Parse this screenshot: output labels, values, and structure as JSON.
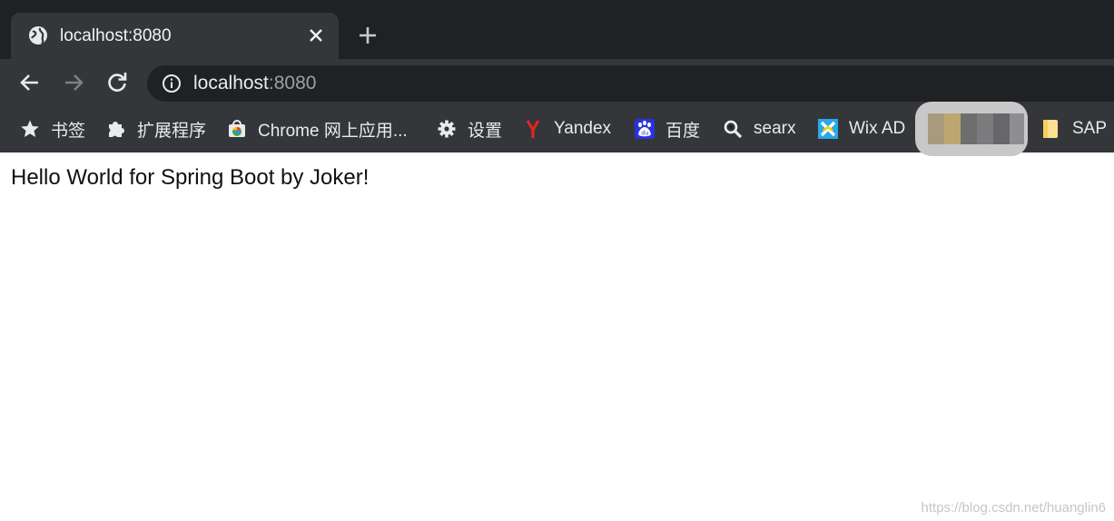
{
  "tab": {
    "title": "localhost:8080",
    "favicon": "globe-icon",
    "close_icon": "close-icon"
  },
  "new_tab_icon": "plus-icon",
  "toolbar": {
    "back_icon": "back-arrow-icon",
    "forward_icon": "forward-arrow-icon",
    "reload_icon": "reload-icon"
  },
  "omnibox": {
    "info_icon": "info-icon",
    "host": "localhost",
    "port": ":8080"
  },
  "bookmarks": [
    {
      "label": "书签",
      "icon": "star-icon"
    },
    {
      "label": "扩展程序",
      "icon": "puzzle-icon"
    },
    {
      "label": "Chrome 网上应用...",
      "icon": "chrome-store-icon"
    },
    {
      "label": "设置",
      "icon": "gear-icon"
    },
    {
      "label": "Yandex",
      "icon": "yandex-icon"
    },
    {
      "label": "百度",
      "icon": "baidu-icon"
    },
    {
      "label": "searx",
      "icon": "searx-icon"
    },
    {
      "label": "Wix AD",
      "icon": "wix-icon"
    },
    {
      "label": "SAP",
      "icon": "folder-icon"
    }
  ],
  "page": {
    "text": "Hello World for Spring Boot by Joker!"
  },
  "watermark": "https://blog.csdn.net/huanglin6",
  "colors": {
    "titlebar": "#202124",
    "toolbar": "#35363a",
    "text_light": "#e8eaed",
    "yandex_red": "#e52620",
    "baidu_blue": "#2932e1"
  }
}
